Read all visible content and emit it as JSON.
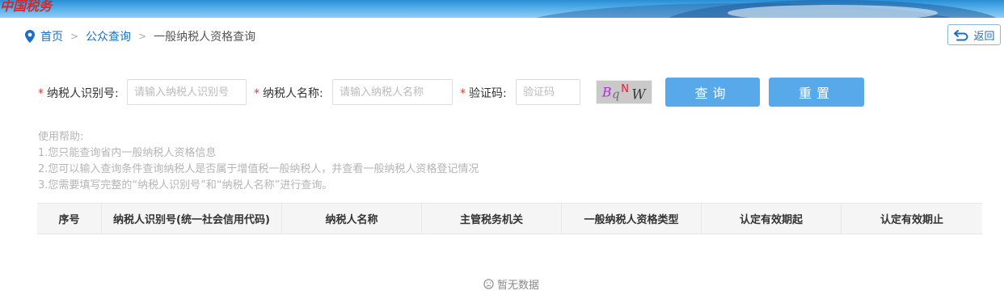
{
  "banner": {
    "logo_text": "中国税务"
  },
  "breadcrumb": {
    "home": "首页",
    "public_query": "公众查询",
    "current": "一般纳税人资格查询",
    "separator": ">"
  },
  "back_button": {
    "label": "返回"
  },
  "form": {
    "taxpayer_id": {
      "label": "纳税人识别号:",
      "placeholder": "请输入纳税人识别号",
      "value": ""
    },
    "taxpayer_name": {
      "label": "纳税人名称:",
      "placeholder": "请输入纳税人名称",
      "value": ""
    },
    "captcha": {
      "label": "验证码:",
      "placeholder": "验证码",
      "value": "",
      "image_text": "BqNW"
    },
    "required_mark": "*",
    "search_button": "查询",
    "reset_button": "重置"
  },
  "help": {
    "title": "使用帮助:",
    "lines": [
      "1.您只能查询省内一般纳税人资格信息",
      "2.您可以输入查询条件查询纳税人是否属于增值税一般纳税人，并查看一般纳税人资格登记情况",
      "3.您需要填写完整的“纳税人识别号”和“纳税人名称”进行查询。"
    ]
  },
  "table": {
    "columns": [
      "序号",
      "纳税人识别号(统一社会信用代码)",
      "纳税人名称",
      "主管税务机关",
      "一般纳税人资格类型",
      "认定有效期起",
      "认定有效期止"
    ]
  },
  "empty_state": {
    "text": "暂无数据"
  },
  "colors": {
    "accent": "#58a9ea",
    "link": "#1a6fc4",
    "required": "#e33333",
    "help_text": "#b5b5b5"
  }
}
